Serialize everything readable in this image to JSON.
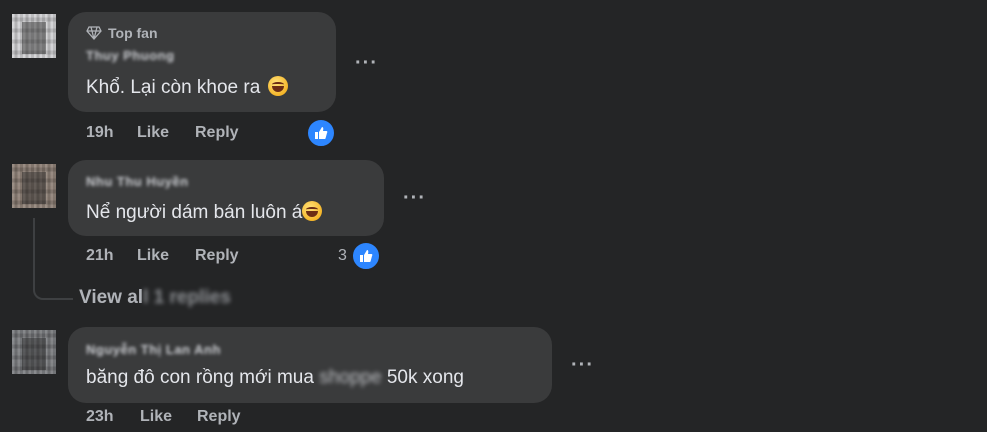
{
  "comments": [
    {
      "badge": "Top fan",
      "author": "Thuy Phuong",
      "text": "Khổ. Lại còn khoe ra",
      "time": "19h",
      "like": "Like",
      "reply": "Reply",
      "reactions": ""
    },
    {
      "author": "Nhu Thu Huyền",
      "text": "Nể người dám bán luôn á",
      "time": "21h",
      "like": "Like",
      "reply": "Reply",
      "reactions": "3"
    },
    {
      "author": "Nguyễn Thị Lan Anh",
      "text_before": "băng đô con rồng mới mua",
      "text_blurred": "shoppe",
      "text_after": "50k xong",
      "time": "23h",
      "like": "Like",
      "reply": "Reply",
      "reactions": ""
    }
  ],
  "view_replies": {
    "visible": "View al",
    "blurred": "l 1 replies"
  },
  "more_icon": "more-horizontal-icon",
  "accent_color": "#2d86ff"
}
